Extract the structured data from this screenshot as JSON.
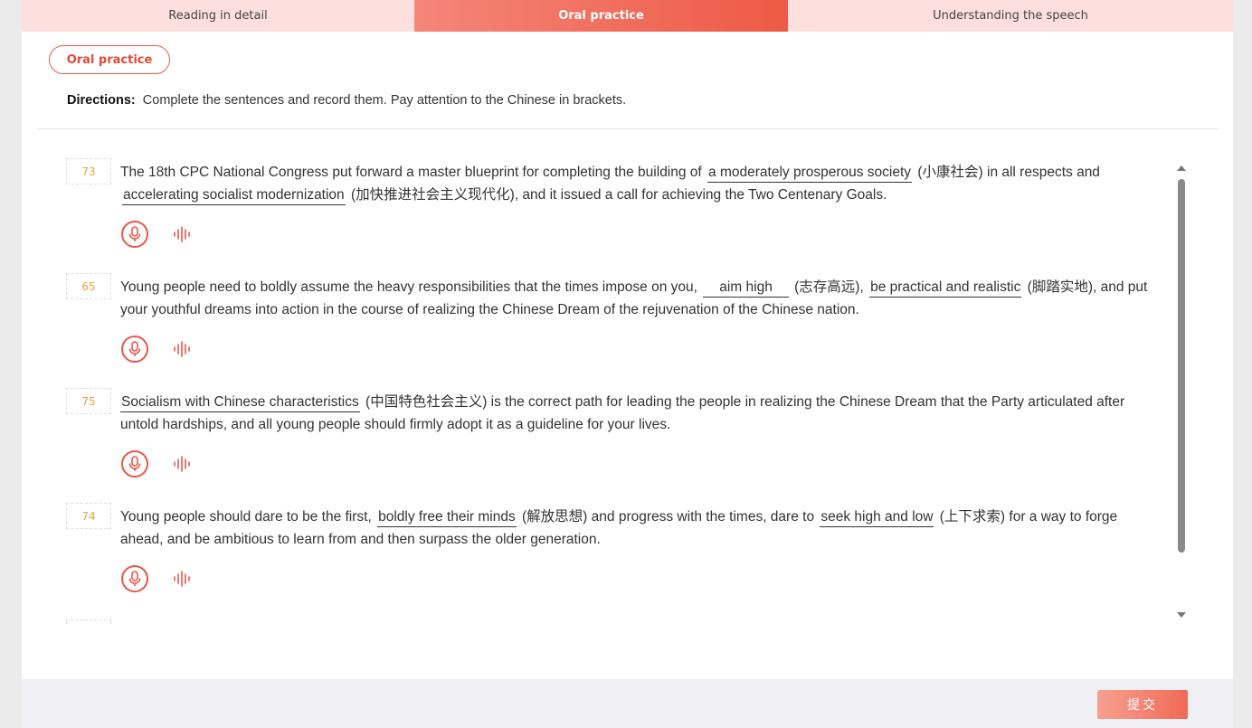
{
  "tabs": [
    {
      "label": "Reading in detail"
    },
    {
      "label": "Oral practice"
    },
    {
      "label": "Understanding the speech"
    }
  ],
  "section_title": "Oral practice",
  "directions": {
    "label": "Directions:",
    "text": "Complete the sentences and record them. Pay attention to the Chinese in brackets."
  },
  "items": [
    {
      "number": "73",
      "parts": [
        "The 18th CPC National Congress put forward a master blueprint for completing the building of ",
        "a moderately prosperous society",
        " (小康社会) in all respects and ",
        "accelerating socialist modernization",
        " (加快推进社会主义现代化), and it issued a call for achieving the Two Centenary Goals."
      ]
    },
    {
      "number": "65",
      "parts": [
        "Young people need to boldly assume the heavy responsibilities that the times impose on you, ",
        "aim high",
        " (志存高远), ",
        "be practical and realistic",
        " (脚踏实地), and put your youthful dreams into action in the course of realizing the Chinese Dream of the rejuvenation of the Chinese nation."
      ]
    },
    {
      "number": "75",
      "parts": [
        "",
        "Socialism with Chinese characteristics",
        " (中国特色社会主义) is the correct path for leading the people in realizing the Chinese Dream that the Party articulated after untold hardships, and all young people should firmly adopt it as a guideline for your lives.",
        "",
        ""
      ]
    },
    {
      "number": "74",
      "parts": [
        "Young people should dare to be the first, ",
        "boldly free their minds",
        " (解放思想) and progress with the times, dare to ",
        "seek high and low",
        " (上下求索) for a way to forge ahead, and be ambitious to learn from and then surpass the older generation."
      ]
    }
  ],
  "submit_label": "提交",
  "colors": {
    "accent": "#e9584a",
    "number": "#e8a23a",
    "tab_bg": "#fde0dd"
  },
  "icons": {
    "record": "microphone-icon",
    "playback": "audio-wave-icon"
  }
}
